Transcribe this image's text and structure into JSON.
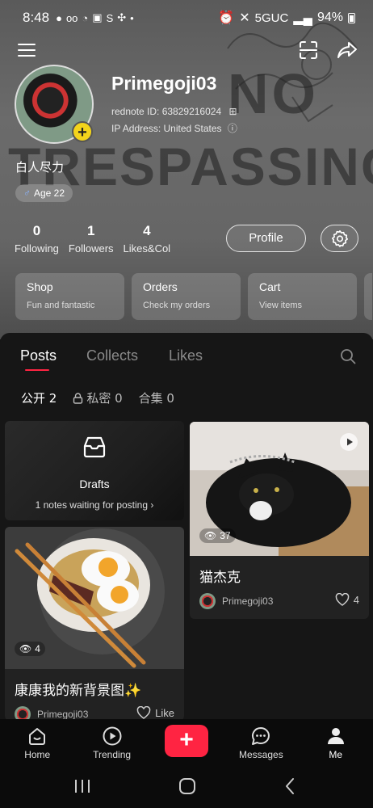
{
  "status_bar": {
    "time": "8:48",
    "network": "5GUC",
    "battery": "94%"
  },
  "background_text": {
    "line1": "NO",
    "line2": "TRESPASSING"
  },
  "profile": {
    "username": "Primegoji03",
    "rednote_id": "rednote ID: 63829216024",
    "ip_address": "IP Address: United States",
    "bio": "白人尽力",
    "age_tag": "Age 22",
    "stats": [
      {
        "num": "0",
        "label": "Following"
      },
      {
        "num": "1",
        "label": "Followers"
      },
      {
        "num": "4",
        "label": "Likes&Col"
      }
    ],
    "profile_button": "Profile"
  },
  "shortcut_cards": [
    {
      "title": "Shop",
      "sub": "Fun and fantastic"
    },
    {
      "title": "Orders",
      "sub": "Check my orders"
    },
    {
      "title": "Cart",
      "sub": "View items"
    }
  ],
  "tabs": [
    {
      "label": "Posts",
      "active": true
    },
    {
      "label": "Collects",
      "active": false
    },
    {
      "label": "Likes",
      "active": false
    }
  ],
  "subtabs": [
    {
      "label": "公开 2",
      "active": true
    },
    {
      "label": "私密 0",
      "active": false
    },
    {
      "label": "合集 0",
      "active": false
    }
  ],
  "drafts": {
    "title": "Drafts",
    "sub": "1 notes waiting for posting"
  },
  "posts": [
    {
      "title": "猫杰克",
      "views": "37",
      "author": "Primegoji03",
      "likes": "4"
    },
    {
      "title": "康康我的新背景图✨",
      "views": "4",
      "author": "Primegoji03",
      "likes": "Like"
    }
  ],
  "bottom_nav": [
    {
      "label": "Home",
      "icon": "home-icon"
    },
    {
      "label": "Trending",
      "icon": "play-icon"
    },
    {
      "label": "",
      "icon": "plus-icon"
    },
    {
      "label": "Messages",
      "icon": "chat-icon"
    },
    {
      "label": "Me",
      "icon": "person-icon"
    }
  ],
  "colors": {
    "accent": "#ff2442",
    "avatar_badge": "#f3d41b"
  }
}
